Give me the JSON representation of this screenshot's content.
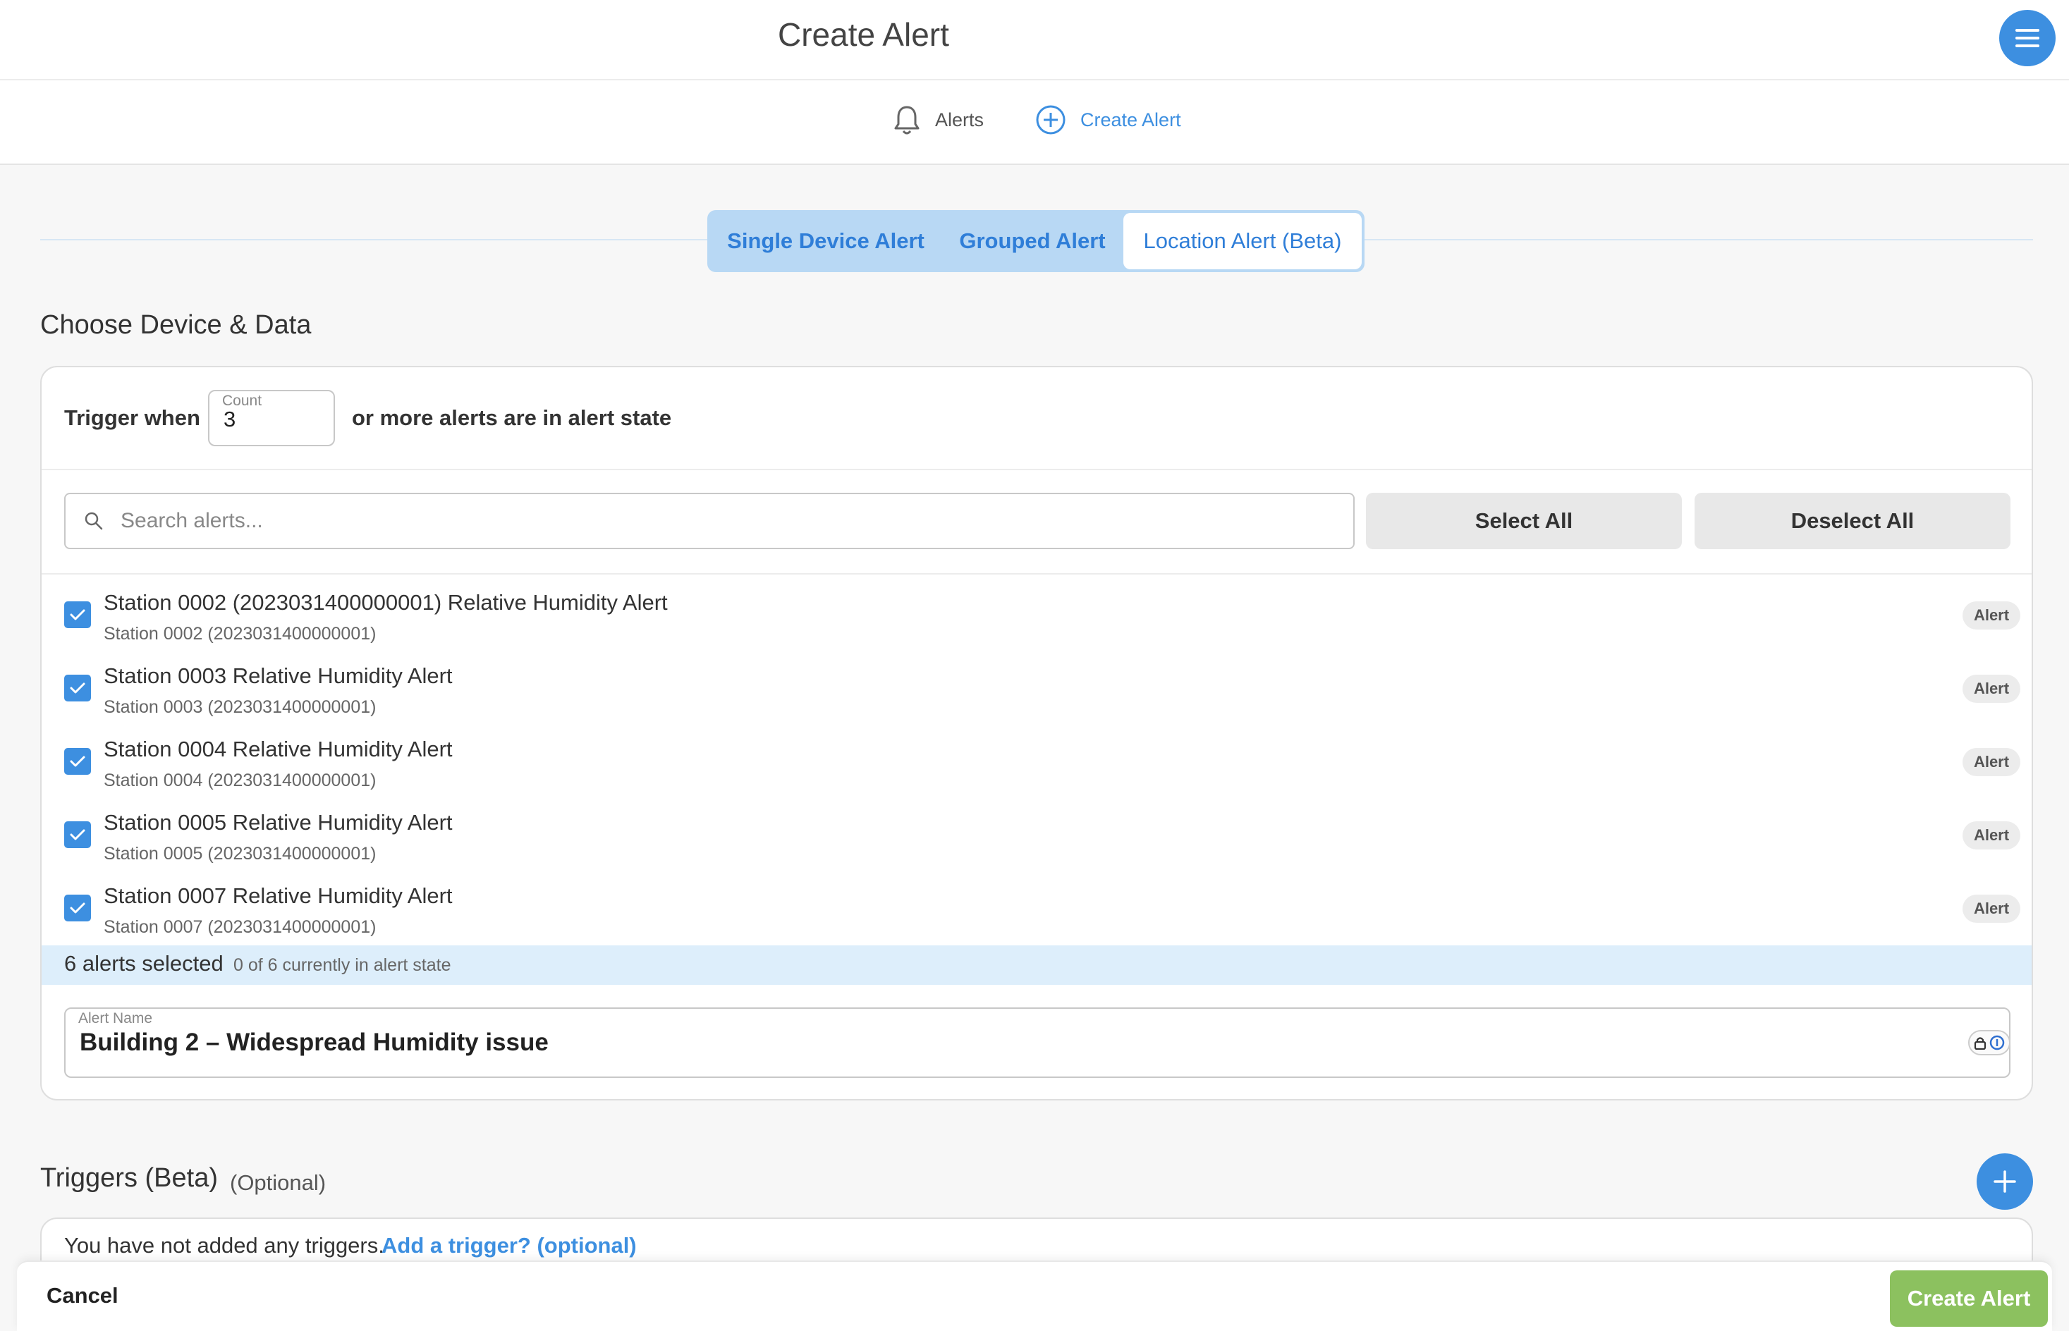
{
  "header": {
    "title": "Create Alert"
  },
  "nav": {
    "alerts_label": "Alerts",
    "create_label": "Create Alert"
  },
  "tabs": [
    {
      "label": "Single Device Alert",
      "active": false
    },
    {
      "label": "Grouped Alert",
      "active": false
    },
    {
      "label": "Location Alert (Beta)",
      "active": true
    }
  ],
  "device_section": {
    "title": "Choose Device & Data",
    "trigger_prefix": "Trigger when",
    "count_label": "Count",
    "count_value": "3",
    "trigger_suffix": "or more alerts are in alert state",
    "search_placeholder": "Search alerts...",
    "select_all_label": "Select All",
    "deselect_all_label": "Deselect All",
    "alerts": [
      {
        "title": "Station 0002 (2023031400000001) Relative Humidity Alert",
        "subtitle": "Station 0002 (2023031400000001)",
        "badge": "Alert",
        "checked": true
      },
      {
        "title": "Station 0003 Relative Humidity Alert",
        "subtitle": "Station 0003 (2023031400000001)",
        "badge": "Alert",
        "checked": true
      },
      {
        "title": "Station 0004 Relative Humidity Alert",
        "subtitle": "Station 0004 (2023031400000001)",
        "badge": "Alert",
        "checked": true
      },
      {
        "title": "Station 0005 Relative Humidity Alert",
        "subtitle": "Station 0005 (2023031400000001)",
        "badge": "Alert",
        "checked": true
      },
      {
        "title": "Station 0007 Relative Humidity Alert",
        "subtitle": "Station 0007 (2023031400000001)",
        "badge": "Alert",
        "checked": true
      }
    ],
    "summary_selected": "6 alerts selected",
    "summary_state": "0 of 6 currently in alert state",
    "alert_name_label": "Alert Name",
    "alert_name_value": "Building 2 – Widespread Humidity issue"
  },
  "triggers": {
    "title": "Triggers (Beta)",
    "optional": "(Optional)",
    "empty_text": "You have not added any triggers.",
    "add_link": "Add a trigger? (optional)"
  },
  "footer": {
    "cancel_label": "Cancel",
    "create_label": "Create Alert"
  },
  "colors": {
    "primary": "#3d8fe0",
    "tab_bg": "#b8d8f4",
    "create_button": "#8cc15f",
    "summary_bg": "#ddeefb"
  },
  "icons": {
    "menu": "hamburger-icon",
    "alerts": "bell-icon",
    "create": "plus-circle-icon",
    "search": "search-icon",
    "check": "checkmark-icon",
    "add": "plus-icon",
    "password_manager": "lock-icon"
  }
}
